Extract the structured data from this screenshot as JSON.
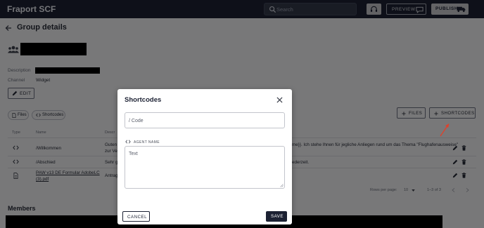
{
  "topbar": {
    "brand": "Fraport SCF",
    "search_placeholder": "Search",
    "preview_label": "PREVIEW",
    "publish_label": "PUBLISH"
  },
  "page": {
    "title": "Group details",
    "description_label": "Description",
    "channel_label": "Channel",
    "channel_value": "Widget",
    "edit_label": "EDIT"
  },
  "tabs": {
    "files_chip": "Files",
    "shortcodes_chip": "Shortcodes",
    "files_button": "FILES",
    "shortcodes_button": "SHORTCODES"
  },
  "table": {
    "headers": [
      "Type",
      "Name",
      "Descr"
    ],
    "rows": [
      {
        "name": "/Willkommen",
        "desc_line1": "Guten",
        "desc_line2": "zur Ve",
        "desc_tail": "me}}. Ich stehe Ihnen für jegliche Anliegen rund um das Thema \"Flughafenausweise\""
      },
      {
        "name": "/Abschied",
        "desc_line1": "Sehr g",
        "desc_tail": "ederzeit."
      },
      {
        "name_line1": "PAW v13 DE Formular AdobeLC",
        "name_line2": "(3).pdf",
        "desc_line1": "Antrag"
      }
    ],
    "rows_per_page_label": "Rows per page:",
    "rows_per_page_value": "10",
    "pagination_text": "1–3 of 3"
  },
  "members": {
    "title": "Members"
  },
  "modal": {
    "title": "Shortcodes",
    "code_placeholder": "/ Code",
    "agent_name_label": "AGENT NAME",
    "text_placeholder": "Text",
    "cancel_label": "CANCEL",
    "save_label": "SAVE"
  },
  "icons": {
    "search": "search-icon",
    "headset": "headset-icon",
    "chat": "chat-icon",
    "truck": "truck-icon",
    "back": "arrow-left-icon",
    "group": "group-icon",
    "pencil": "pencil-icon",
    "code": "code-icon",
    "file": "file-icon",
    "plus": "plus-icon",
    "trash": "trash-icon",
    "close": "close-icon"
  },
  "colors": {
    "topbar": "#1c2133",
    "primary": "#1c2133",
    "overlay": "#000000",
    "annotation_arrow": "#e0402a"
  }
}
